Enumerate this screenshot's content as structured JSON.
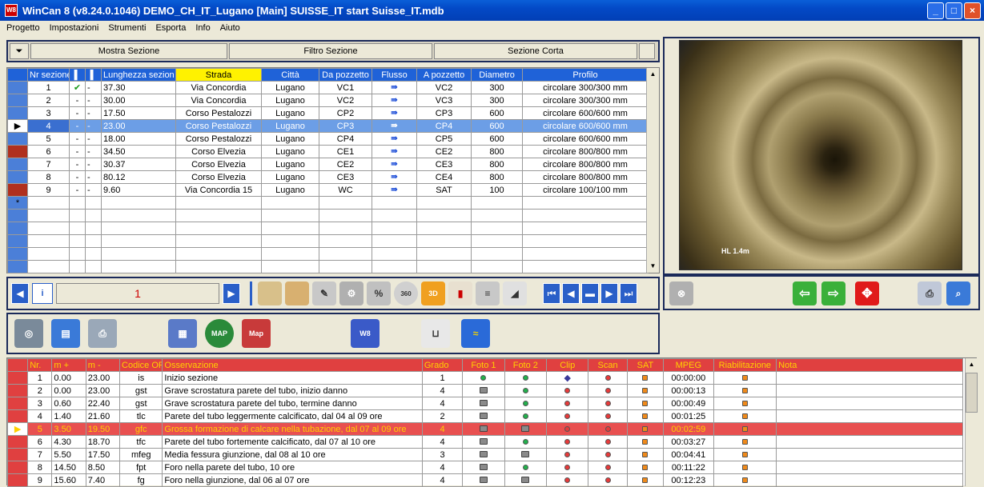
{
  "title": "WinCan 8  (v8.24.0.1046) DEMO_CH_IT_Lugano [Main]  SUISSE_IT  start  Suisse_IT.mdb",
  "menu": [
    "Progetto",
    "Impostazioni",
    "Strumenti",
    "Esporta",
    "Info",
    "Aiuto"
  ],
  "filterbar": {
    "show": "Mostra Sezione",
    "filter": "Filtro Sezione",
    "short": "Sezione Corta"
  },
  "sections": {
    "headers": [
      "Nr sezione",
      "",
      "",
      "Lunghezza sezion",
      "Strada",
      "Città",
      "Da pozzetto",
      "Flusso",
      "A pozzetto",
      "Diametro",
      "Profilo"
    ],
    "rows": [
      {
        "nr": "1",
        "c1": "✔",
        "c2": "-",
        "len": "37.30",
        "strada": "Via Concordia",
        "citta": "Lugano",
        "da": "VC1",
        "a": "VC2",
        "dia": "300",
        "profilo": "circolare 300/300 mm"
      },
      {
        "nr": "2",
        "c1": "-",
        "c2": "-",
        "len": "30.00",
        "strada": "Via Concordia",
        "citta": "Lugano",
        "da": "VC2",
        "a": "VC3",
        "dia": "300",
        "profilo": "circolare 300/300 mm"
      },
      {
        "nr": "3",
        "c1": "-",
        "c2": "-",
        "len": "17.50",
        "strada": "Corso Pestalozzi",
        "citta": "Lugano",
        "da": "CP2",
        "a": "CP3",
        "dia": "600",
        "profilo": "circolare 600/600 mm"
      },
      {
        "nr": "4",
        "c1": "-",
        "c2": "-",
        "len": "23.00",
        "strada": "Corso Pestalozzi",
        "citta": "Lugano",
        "da": "CP3",
        "a": "CP4",
        "dia": "600",
        "profilo": "circolare 600/600 mm"
      },
      {
        "nr": "5",
        "c1": "-",
        "c2": "-",
        "len": "18.00",
        "strada": "Corso Pestalozzi",
        "citta": "Lugano",
        "da": "CP4",
        "a": "CP5",
        "dia": "600",
        "profilo": "circolare 600/600 mm"
      },
      {
        "nr": "6",
        "c1": "-",
        "c2": "-",
        "len": "34.50",
        "strada": "Corso Elvezia",
        "citta": "Lugano",
        "da": "CE1",
        "a": "CE2",
        "dia": "800",
        "profilo": "circolare 800/800 mm"
      },
      {
        "nr": "7",
        "c1": "-",
        "c2": "-",
        "len": "30.37",
        "strada": "Corso Elvezia",
        "citta": "Lugano",
        "da": "CE2",
        "a": "CE3",
        "dia": "800",
        "profilo": "circolare 800/800 mm"
      },
      {
        "nr": "8",
        "c1": "-",
        "c2": "-",
        "len": "80.12",
        "strada": "Corso Elvezia",
        "citta": "Lugano",
        "da": "CE3",
        "a": "CE4",
        "dia": "800",
        "profilo": "circolare 800/800 mm"
      },
      {
        "nr": "9",
        "c1": "-",
        "c2": "-",
        "len": "9.60",
        "strada": "Via Concordia 15",
        "citta": "Lugano",
        "da": "WC",
        "a": "SAT",
        "dia": "100",
        "profilo": "circolare 100/100 mm"
      }
    ]
  },
  "nav": {
    "record": "1"
  },
  "video": {
    "overlay": "HL      1.4m"
  },
  "observations": {
    "headers": [
      "Nr.",
      "m +",
      "m -",
      "Codice OP",
      "Osservazione",
      "Grado",
      "Foto 1",
      "Foto 2",
      "Clip",
      "Scan",
      "SAT",
      "MPEG",
      "Riabilitazione",
      "Nota"
    ],
    "rows": [
      {
        "nr": "1",
        "mp": "0.00",
        "mm": "23.00",
        "code": "is",
        "oss": "Inizio sezione",
        "grado": "1",
        "mpeg": "00:00:00"
      },
      {
        "nr": "2",
        "mp": "0.00",
        "mm": "23.00",
        "code": "gst",
        "oss": "Grave scrostatura parete del tubo, inizio danno",
        "grado": "4",
        "mpeg": "00:00:13"
      },
      {
        "nr": "3",
        "mp": "0.60",
        "mm": "22.40",
        "code": "gst",
        "oss": "Grave scrostatura parete del tubo, termine danno",
        "grado": "4",
        "mpeg": "00:00:49"
      },
      {
        "nr": "4",
        "mp": "1.40",
        "mm": "21.60",
        "code": "tlc",
        "oss": "Parete del tubo leggermente calcificato, dal 04 al 09 ore",
        "grado": "2",
        "mpeg": "00:01:25"
      },
      {
        "nr": "5",
        "mp": "3.50",
        "mm": "19.50",
        "code": "gfc",
        "oss": "Grossa formazione di calcare nella tubazione, dal 07 al 09 ore",
        "grado": "4",
        "mpeg": "00:02:59"
      },
      {
        "nr": "6",
        "mp": "4.30",
        "mm": "18.70",
        "code": "tfc",
        "oss": "Parete del tubo fortemente calcificato, dal 07 al 10 ore",
        "grado": "4",
        "mpeg": "00:03:27"
      },
      {
        "nr": "7",
        "mp": "5.50",
        "mm": "17.50",
        "code": "mfeg",
        "oss": "Media fessura giunzione, dal 08 al 10 ore",
        "grado": "3",
        "mpeg": "00:04:41"
      },
      {
        "nr": "8",
        "mp": "14.50",
        "mm": "8.50",
        "code": "fpt",
        "oss": "Foro nella parete del tubo,  10 ore",
        "grado": "4",
        "mpeg": "00:11:22"
      },
      {
        "nr": "9",
        "mp": "15.60",
        "mm": "7.40",
        "code": "fg",
        "oss": "Foro nella giunzione, dal 06 al 07 ore",
        "grado": "4",
        "mpeg": "00:12:23"
      }
    ]
  },
  "icons": [
    "binoculars-icon",
    "report-icon",
    "printer-icon",
    "grid-icon",
    "map-icon",
    "map-v8-icon",
    "wincan-icon",
    "toilet-icon",
    "ruler-icon"
  ]
}
